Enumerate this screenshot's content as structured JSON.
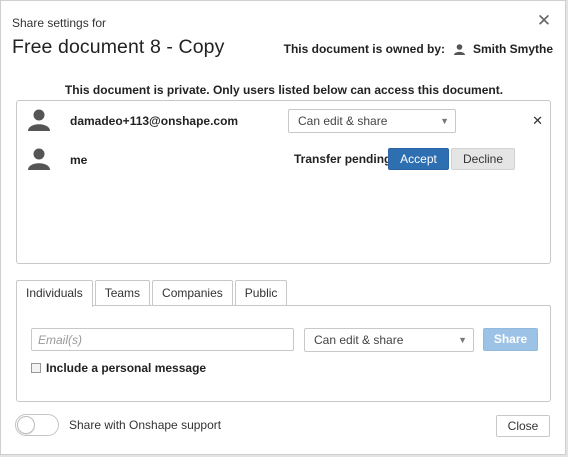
{
  "dialog": {
    "subtitle": "Share settings for",
    "title": "Free document 8 - Copy",
    "close_icon": "close-icon",
    "owner_label": "This document is owned by:",
    "owner_name": "Smith Smythe",
    "private_note": "This document is private. Only users listed below can access this document."
  },
  "users": [
    {
      "name": "damadeo+113@onshape.com",
      "permission": "Can edit & share",
      "remove_icon": "close-icon"
    },
    {
      "name": "me",
      "status": "Transfer pending",
      "accept_label": "Accept",
      "decline_label": "Decline"
    }
  ],
  "tabs": [
    {
      "label": "Individuals"
    },
    {
      "label": "Teams"
    },
    {
      "label": "Companies"
    },
    {
      "label": "Public"
    }
  ],
  "share_form": {
    "email_value": "",
    "email_placeholder": "Email(s)",
    "permission": "Can edit & share",
    "share_label": "Share",
    "personal_message_label": "Include a personal message"
  },
  "footer": {
    "support_toggle_label": "Share with Onshape support",
    "support_toggle_on": false,
    "close_label": "Close"
  },
  "colors": {
    "accent": "#2e6fb2",
    "share_disabled": "#9cc2e6",
    "decline_bg": "#e5e5e5"
  }
}
